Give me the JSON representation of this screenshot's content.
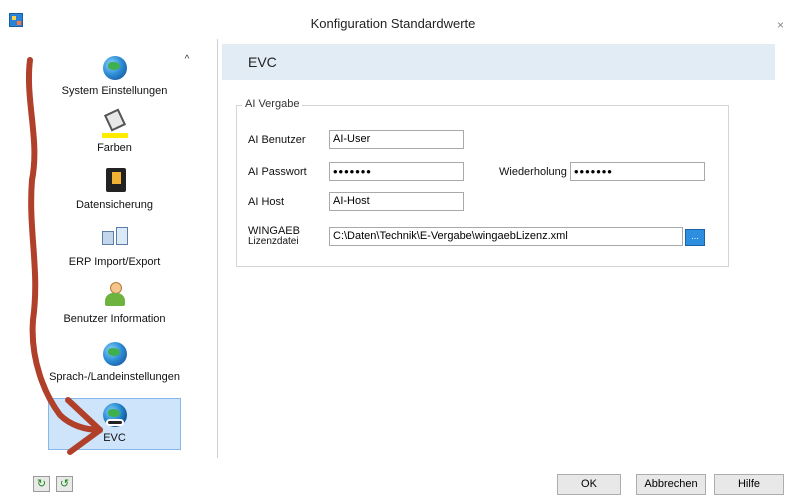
{
  "window": {
    "title": "Konfiguration Standardwerte",
    "close": "×"
  },
  "sidebar": {
    "scroll_up": "^",
    "items": [
      {
        "label": "System Einstellungen",
        "icon": "globe-network-icon"
      },
      {
        "label": "Farben",
        "icon": "paint-bucket-icon"
      },
      {
        "label": "Datensicherung",
        "icon": "floppy-disk-icon"
      },
      {
        "label": "ERP Import/Export",
        "icon": "import-export-icon"
      },
      {
        "label": "Benutzer Information",
        "icon": "user-icon"
      },
      {
        "label": "Sprach-/Landeinstellungen",
        "icon": "globe-icon"
      },
      {
        "label": "EVC",
        "icon": "globe-link-icon",
        "selected": true
      }
    ]
  },
  "main": {
    "header": "EVC",
    "group_title": "AI Vergabe",
    "fields": {
      "benutzer_label": "AI Benutzer",
      "benutzer_value": "AI-User",
      "passwort_label": "AI Passwort",
      "passwort_value": "•••••••",
      "wiederholung_label": "Wiederholung",
      "wiederholung_value": "•••••••",
      "host_label": "AI Host",
      "host_value": "AI-Host",
      "lizenz_label_1": "WINGAEB",
      "lizenz_label_2": "Lizenzdatei",
      "lizenz_value": "C:\\Daten\\Technik\\E-Vergabe\\wingaebLizenz.xml",
      "browse": "..."
    }
  },
  "footer": {
    "ok": "OK",
    "cancel": "Abbrechen",
    "help": "Hilfe",
    "small_btn_1": "↻",
    "small_btn_2": "↺"
  },
  "colors": {
    "accent_header": "#e1ecf5",
    "selected_item": "#cde4fb",
    "annotation_arrow": "#b0402a"
  }
}
